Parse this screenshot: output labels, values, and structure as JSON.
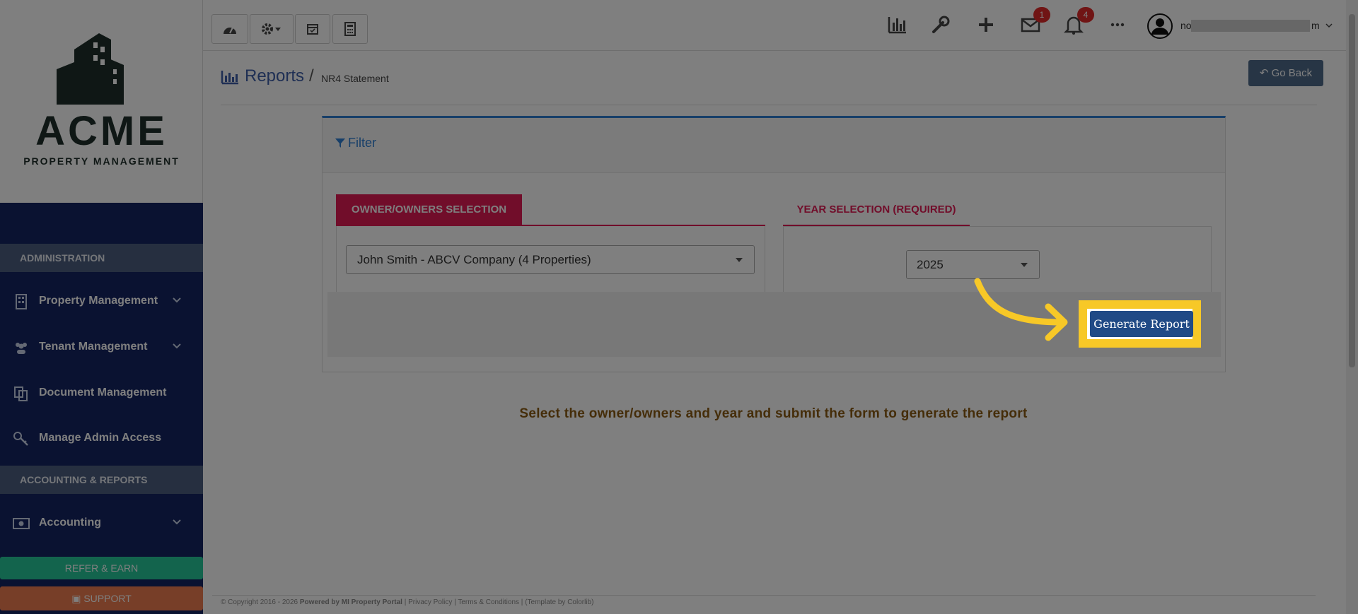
{
  "brand": {
    "name": "ACME",
    "tagline": "PROPERTY MANAGEMENT"
  },
  "sidebar": {
    "sections": [
      {
        "title": "ADMINISTRATION"
      },
      {
        "title": "ACCOUNTING & REPORTS"
      }
    ],
    "items": [
      {
        "label": "Property Management",
        "icon": "building-icon",
        "has_chevron": true
      },
      {
        "label": "Tenant Management",
        "icon": "users-icon",
        "has_chevron": true
      },
      {
        "label": "Document Management",
        "icon": "documents-icon",
        "has_chevron": false
      },
      {
        "label": "Manage Admin Access",
        "icon": "key-icon",
        "has_chevron": false
      },
      {
        "label": "Accounting",
        "icon": "money-icon",
        "has_chevron": true
      }
    ],
    "refer_label": "REFER & EARN",
    "support_label": "SUPPORT"
  },
  "topbar": {
    "left_buttons": [
      "dashboard-icon",
      "settings-icon",
      "calendar-icon",
      "calculator-icon"
    ],
    "right_icons": [
      "chart-icon",
      "wrench-icon",
      "plus-icon",
      "mail-icon",
      "bell-icon",
      "more-icon"
    ],
    "mail_badge": "1",
    "bell_badge": "4",
    "user_name_prefix": "no",
    "user_name_suffix": "m"
  },
  "breadcrumb": {
    "title": "Reports",
    "separator": "/",
    "current": "NR4 Statement"
  },
  "go_back_label": "Go Back",
  "filter": {
    "heading": "Filter",
    "owner_tab_label": "OWNER/OWNERS SELECTION",
    "owner_value": "John Smith - ABCV Company (4 Properties)",
    "year_tab_label": "YEAR SELECTION (REQUIRED)",
    "year_value": "2025",
    "submit_label": "Generate Report"
  },
  "hint_text": "Select the owner/owners and year and submit the form to generate the report",
  "footer": {
    "copyright": "© Copyright 2016 - 2026",
    "powered": "Powered by MI Property Portal",
    "privacy": "Privacy Policy",
    "terms": "Terms & Conditions",
    "template": "(Template by Colorlib)"
  },
  "colors": {
    "sidebar_bg": "#142463",
    "accent_pink": "#e31a54",
    "primary_blue": "#204a86",
    "highlight_yellow": "#f7c827"
  }
}
